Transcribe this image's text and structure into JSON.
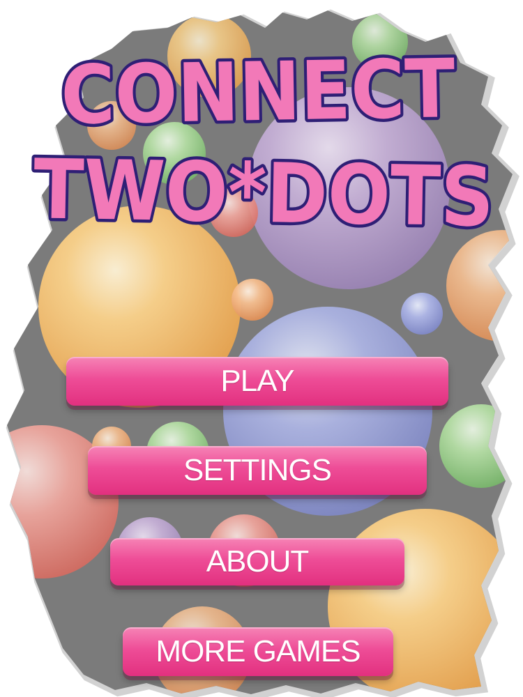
{
  "title": {
    "line1": "CONNECT",
    "line2": "TWO*DOTS"
  },
  "menu": {
    "play": "PLAY",
    "settings": "SETTINGS",
    "about": "ABOUT",
    "more_games": "MORE GAMES"
  },
  "colors": {
    "background": "#ffffff",
    "board": "#7b7b7b",
    "title_fill": "#f279b8",
    "title_outline": "#2e1f75",
    "button": "#ee4d97",
    "button_text": "#ffffff"
  }
}
